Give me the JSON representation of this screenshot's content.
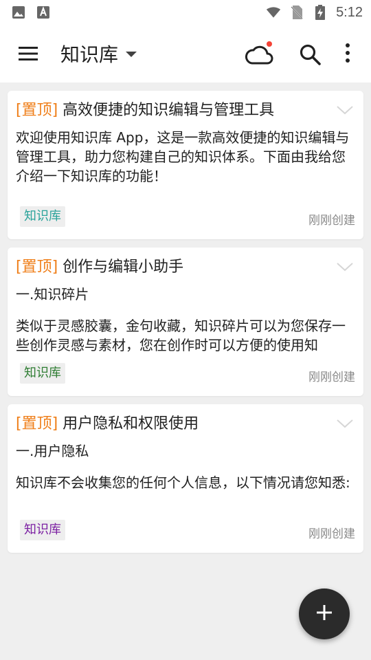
{
  "status_bar": {
    "time": "5:12",
    "icons": [
      "image-icon",
      "font-a-icon",
      "wifi-icon",
      "no-sim-icon",
      "battery-charging-icon"
    ]
  },
  "app_bar": {
    "title": "知识库",
    "icons": [
      "menu-icon",
      "dropdown-arrow-icon",
      "cloud-sync-icon",
      "search-icon",
      "more-vert-icon"
    ],
    "cloud_badge_color": "#f44336"
  },
  "notes": [
    {
      "pin_label": "[置顶]",
      "title": "高效便捷的知识编辑与管理工具",
      "body_lines": [
        "欢迎使用知识库 App，这是一款高效便捷的知识编辑与管理工具，助力您构建自己的知识体系。下面由我给您介绍一下知识库的功能！"
      ],
      "section": "",
      "tag": "知识库",
      "tag_color": "#2aa39a",
      "created": "刚刚创建"
    },
    {
      "pin_label": "[置顶]",
      "title": "创作与编辑小助手",
      "section": "一.知识碎片",
      "body_lines": [
        "类似于灵感胶囊，金句收藏，知识碎片可以为您保存一些创作灵感与素材，您在创作时可以方便的使用知"
      ],
      "tag": "知识库",
      "tag_color": "#2e7d32",
      "created": "刚刚创建"
    },
    {
      "pin_label": "[置顶]",
      "title": "用户隐私和权限使用",
      "section": "一.用户隐私",
      "body_lines": [
        "知识库不会收集您的任何个人信息，以下情况请您知悉:"
      ],
      "tag": "知识库",
      "tag_color": "#7b1fa2",
      "created": "刚刚创建"
    }
  ],
  "fab": {
    "icon": "plus-icon"
  },
  "colors": {
    "pin": "#ef7f1a",
    "background": "#efefef"
  }
}
